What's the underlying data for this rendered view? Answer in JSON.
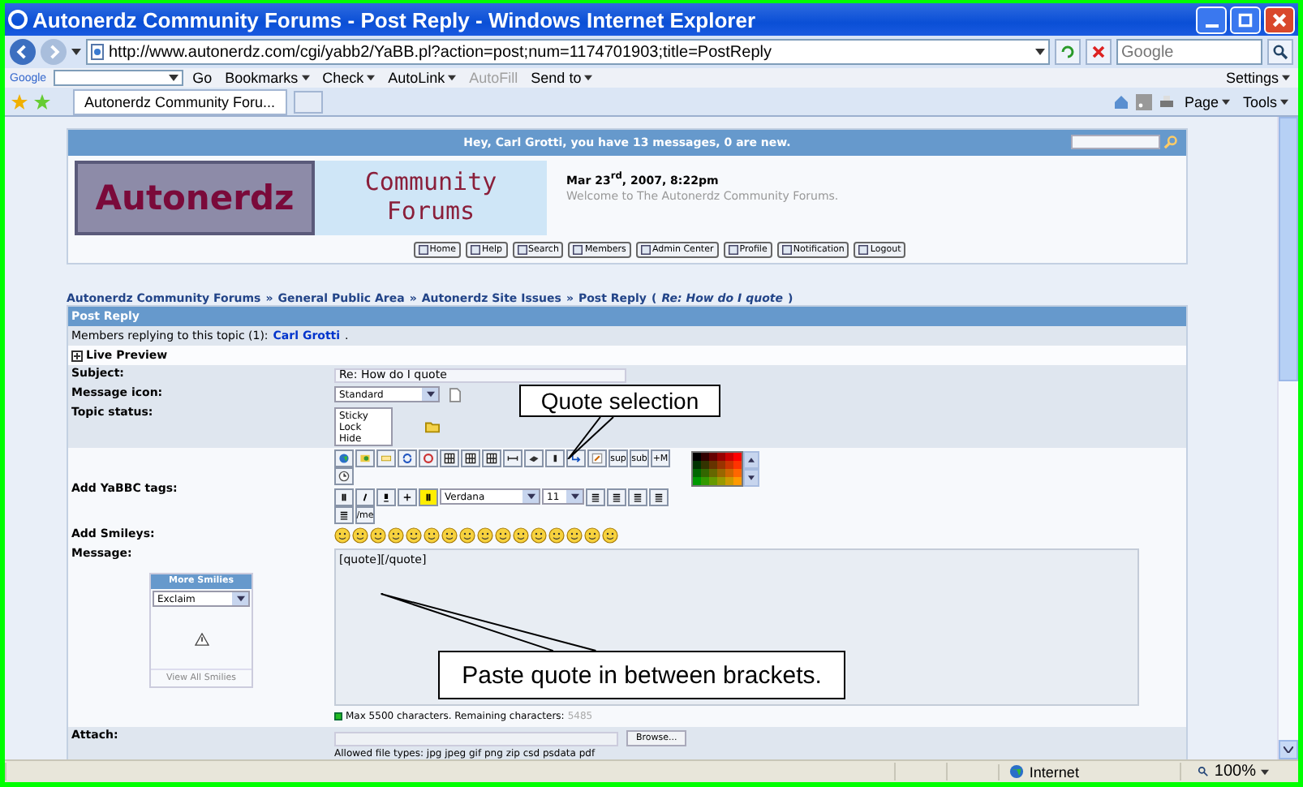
{
  "window": {
    "title": "Autonerdz Community Forums - Post Reply - Windows Internet Explorer"
  },
  "address_bar": {
    "url": "http://www.autonerdz.com/cgi/yabb2/YaBB.pl?action=post;num=1174701903;title=PostReply",
    "search_placeholder": "Google"
  },
  "google_toolbar": {
    "logo": "Google",
    "go": "Go",
    "settings": "Settings",
    "items": [
      {
        "label": "Bookmarks",
        "menu": true,
        "disabled": false
      },
      {
        "label": "Check",
        "menu": true,
        "disabled": false
      },
      {
        "label": "AutoLink",
        "menu": true,
        "disabled": false
      },
      {
        "label": "AutoFill",
        "menu": false,
        "disabled": true
      },
      {
        "label": "Send to",
        "menu": true,
        "disabled": false
      }
    ]
  },
  "tabs": [
    {
      "label": "Autonerdz Community Foru...",
      "selected": true
    }
  ],
  "commands": [
    "Page",
    "Tools"
  ],
  "forum": {
    "welcome": "Hey, Carl Grotti, you have 13 messages, 0 are new.",
    "logo_left": "Autonerdz",
    "logo_right": "Community Forums",
    "date": "Mar 23$^{rd}$, 2007, 8:22pm",
    "tagline": "Welcome to The Autonerdz Community Forums.",
    "nav_buttons": [
      "Home",
      "Help",
      "Search",
      "Members",
      "Admin Center",
      "Profile",
      "Notification",
      "Logout"
    ]
  },
  "breadcrumb": [
    {
      "text": "Autonerdz Community Forums",
      "kind": "link"
    },
    {
      "text": "»",
      "kind": "sep"
    },
    {
      "text": "General Public Area",
      "kind": "link"
    },
    {
      "text": "»",
      "kind": "sep"
    },
    {
      "text": "Autonerdz Site Issues",
      "kind": "link"
    },
    {
      "text": "»",
      "kind": "sep"
    },
    {
      "text": "Post Reply",
      "kind": "link"
    },
    {
      "text": "(",
      "kind": "sep"
    },
    {
      "text": "Re: How do I quote",
      "kind": "topic"
    },
    {
      "text": ")",
      "kind": "sep"
    }
  ],
  "form": {
    "title": "Post Reply",
    "replying_label": "Members replying to this topic (1):",
    "replying_name": "Carl Grotti",
    "replying_suffix": ".",
    "live_preview": {
      "label": "Live Preview",
      "expanded": false
    },
    "subject": {
      "label": "Subject:",
      "value": "Re: How do I quote"
    },
    "message_icon": {
      "label": "Message icon:",
      "value": "Standard"
    },
    "topic_status": {
      "label": "Topic status:",
      "options": [
        {
          "label": "Sticky",
          "selected": false
        },
        {
          "label": "Lock",
          "selected": false
        },
        {
          "label": "Hide",
          "selected": false
        }
      ]
    },
    "tags": {
      "label": "Add YaBBC tags:",
      "text_buttons": [
        "sup",
        "sub",
        "+M"
      ],
      "font": "Verdana",
      "size": "11",
      "me_button": "/me"
    },
    "smileys": {
      "label": "Add Smileys:"
    },
    "message": {
      "label": "Message:",
      "value": "[quote][/quote]",
      "limit": "Max 5500 characters. Remaining characters:",
      "remaining": "5485"
    },
    "more_smilies": {
      "title": "More Smilies",
      "value": "Exclaim",
      "link": "View All Smilies"
    },
    "attach": {
      "label": "Attach:",
      "button": "Browse...",
      "allowed": "Allowed file types: jpg jpeg gif png zip csd psdata pdf"
    }
  },
  "annotations": [
    {
      "text": "Quote selection"
    },
    {
      "text": "Paste quote in between brackets."
    }
  ],
  "status_bar": {
    "zone": "Internet",
    "zoom": "100%"
  }
}
